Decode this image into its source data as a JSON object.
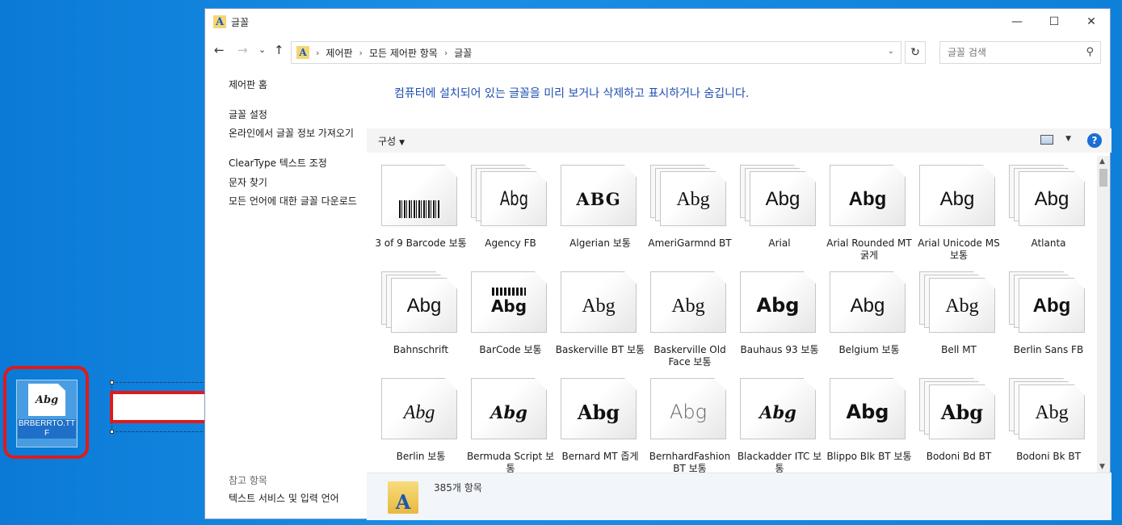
{
  "window": {
    "title": "글꼴",
    "minimize": "—",
    "maximize": "☐",
    "close": "✕"
  },
  "nav": {
    "back": "←",
    "forward": "→",
    "recent": "⌄",
    "up": "↑",
    "refresh": "↻",
    "breadcrumbs": [
      "제어판",
      "모든 제어판 항목",
      "글꼴"
    ],
    "search_placeholder": "글꼴 검색"
  },
  "left_pane": {
    "home": "제어판 홈",
    "links": [
      "글꼴 설정",
      "온라인에서 글꼴 정보 가져오기",
      "ClearType 텍스트 조정",
      "문자 찾기",
      "모든 언어에 대한 글꼴 다운로드"
    ],
    "see_also_heading": "참고 항목",
    "see_also_links": [
      "텍스트 서비스 및 입력 언어"
    ]
  },
  "main": {
    "description": "컴퓨터에 설치되어 있는 글꼴을 미리 보거나 삭제하고 표시하거나 숨깁니다.",
    "organize_label": "구성",
    "help": "?"
  },
  "fonts": [
    {
      "label": "3 of 9 Barcode 보통",
      "sample": "",
      "style": "barcode",
      "stack": false
    },
    {
      "label": "Agency FB",
      "sample": "Abg",
      "style": "condensed",
      "stack": true
    },
    {
      "label": "Algerian 보통",
      "sample": "ABG",
      "style": "algerian",
      "stack": false
    },
    {
      "label": "AmeriGarmnd BT",
      "sample": "Abg",
      "style": "serif",
      "stack": true
    },
    {
      "label": "Arial",
      "sample": "Abg",
      "style": "sans",
      "stack": true
    },
    {
      "label": "Arial Rounded MT 굵게",
      "sample": "Abg",
      "style": "sansbold",
      "stack": false
    },
    {
      "label": "Arial Unicode MS 보통",
      "sample": "Abg",
      "style": "sans",
      "stack": false
    },
    {
      "label": "Atlanta",
      "sample": "Abg",
      "style": "sans",
      "stack": true
    },
    {
      "label": "Bahnschrift",
      "sample": "Abg",
      "style": "sans",
      "stack": true
    },
    {
      "label": "BarCode 보통",
      "sample": "Abg",
      "style": "barcode2",
      "stack": false
    },
    {
      "label": "Baskerville BT 보통",
      "sample": "Abg",
      "style": "serif",
      "stack": false
    },
    {
      "label": "Baskerville Old Face 보통",
      "sample": "Abg",
      "style": "serif",
      "stack": false
    },
    {
      "label": "Bauhaus 93 보통",
      "sample": "Abg",
      "style": "heavy",
      "stack": false
    },
    {
      "label": "Belgium 보통",
      "sample": "Abg",
      "style": "sans",
      "stack": false
    },
    {
      "label": "Bell MT",
      "sample": "Abg",
      "style": "serif",
      "stack": true
    },
    {
      "label": "Berlin Sans FB",
      "sample": "Abg",
      "style": "sansbold",
      "stack": true
    },
    {
      "label": "Berlin 보통",
      "sample": "Abg",
      "style": "italic",
      "stack": false
    },
    {
      "label": "Bermuda Script 보통",
      "sample": "Abg",
      "style": "script",
      "stack": false
    },
    {
      "label": "Bernard MT 좁게",
      "sample": "Abg",
      "style": "heavyserif",
      "stack": false
    },
    {
      "label": "BernhardFashion BT 보통",
      "sample": "Abg",
      "style": "thin",
      "stack": false
    },
    {
      "label": "Blackadder ITC 보통",
      "sample": "Abg",
      "style": "script",
      "stack": false
    },
    {
      "label": "Blippo Blk BT 보통",
      "sample": "Abg",
      "style": "heavy",
      "stack": false
    },
    {
      "label": "Bodoni Bd BT",
      "sample": "Abg",
      "style": "heavyserif",
      "stack": true
    },
    {
      "label": "Bodoni Bk BT",
      "sample": "Abg",
      "style": "serif",
      "stack": true
    }
  ],
  "details": {
    "count": "385개 항목"
  },
  "desktop": {
    "file_label": "BRBERRTO.TTF",
    "file_sample": "Abg"
  }
}
